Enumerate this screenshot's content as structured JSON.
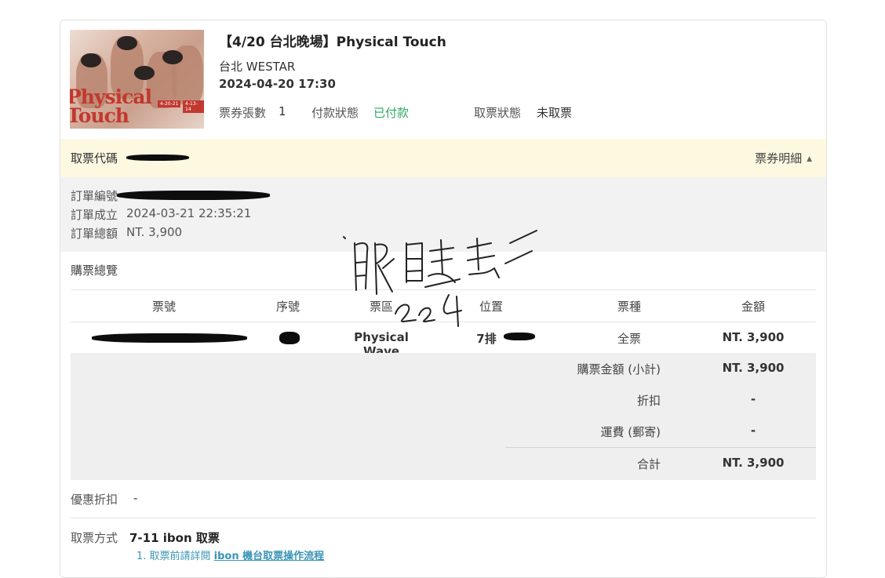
{
  "event": {
    "title": "【4/20 台北晚場】Physical Touch",
    "venue": "台北 WESTAR",
    "datetime": "2024-04-20 17:30",
    "poster": {
      "title_art": "Physical Touch",
      "tag_left": "4-20-21",
      "tag_right": "4-13-14"
    }
  },
  "status": {
    "qty_label": "票券張數",
    "qty_value": "1",
    "pay_label": "付款狀態",
    "pay_value": "已付款",
    "pickup_label": "取票狀態",
    "pickup_value": "未取票"
  },
  "code_bar": {
    "label": "取票代碼",
    "detail_label": "票券明細"
  },
  "order": {
    "no_label": "訂單編號",
    "created_label": "訂單成立",
    "created_value": "2024-03-21 22:35:21",
    "total_label": "訂單總額",
    "total_value": "NT. 3,900"
  },
  "summary_label": "購票總覽",
  "table": {
    "headers": [
      "票號",
      "序號",
      "票區",
      "位置",
      "票種",
      "金額"
    ],
    "row": {
      "zone": "Physical Wave",
      "seat": "7排",
      "type": "全票",
      "amount": "NT. 3,900"
    },
    "subtotal_label": "購票金額 (小計)",
    "subtotal_value": "NT. 3,900",
    "discount_label": "折扣",
    "discount_value": "-",
    "shipping_label": "運費 (郵寄)",
    "shipping_value": "-",
    "grand_label": "合計",
    "grand_value": "NT. 3,900"
  },
  "promo": {
    "label": "優惠折扣",
    "value": "-"
  },
  "pickup": {
    "label": "取票方式",
    "value": "7-11 ibon 取票",
    "note_prefix": "1. 取票前請詳閱 ",
    "note_link": "ibon 機台取票操作流程"
  },
  "colors": {
    "accent_blue": "#3a95b5",
    "paid_green": "#2eaa62",
    "code_bar_bg": "#fdf8e0"
  }
}
